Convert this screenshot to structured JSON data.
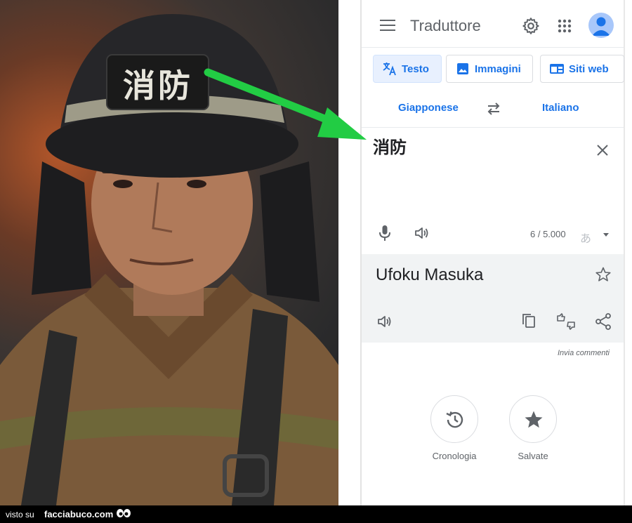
{
  "photo": {
    "helmet_label": "消防"
  },
  "translator": {
    "app_title": "Traduttore",
    "tabs": [
      {
        "label": "Testo",
        "active": true,
        "icon": "translate-icon"
      },
      {
        "label": "Immagini",
        "active": false,
        "icon": "image-icon"
      },
      {
        "label": "Siti web",
        "active": false,
        "icon": "web-icon"
      }
    ],
    "source_language": "Giapponese",
    "target_language": "Italiano",
    "source_text": "消防",
    "char_count": "6 / 5.000",
    "input_method": "あ",
    "translated_text": "Ufoku Masuka",
    "feedback_link": "Invia commenti",
    "history_label": "Cronologia",
    "saved_label": "Salvate",
    "colors": {
      "accent": "#1a73e8",
      "active_tab_bg": "#e8f0fe",
      "result_bg": "#f1f3f4",
      "arrow": "#22cc44"
    }
  },
  "footer": {
    "prefix": "visto su",
    "brand": "facciabuco.com"
  }
}
